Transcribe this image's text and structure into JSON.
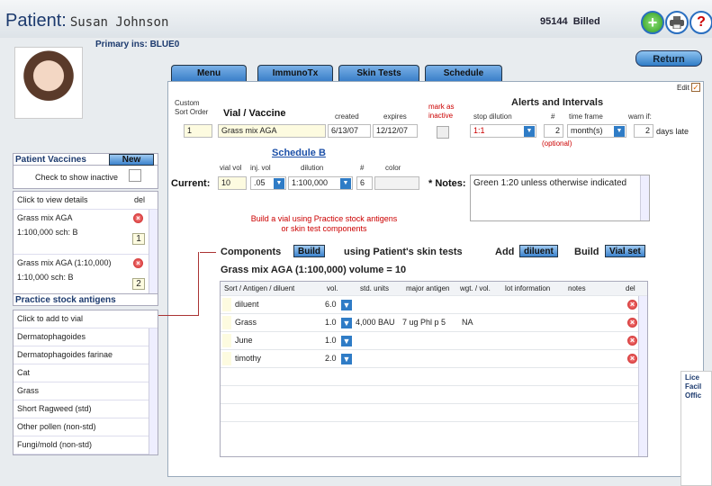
{
  "header": {
    "patient_label": "Patient:",
    "patient_name": "Susan Johnson",
    "account": "95144",
    "billed": "Billed",
    "primary_ins": "Primary ins: BLUE0"
  },
  "actions": {
    "return": "Return",
    "edit": "Edit",
    "edit_check": "✓"
  },
  "tabs": [
    "Menu",
    "ImmunoTx",
    "Skin Tests",
    "Schedule"
  ],
  "vial": {
    "custom_sort_label": "Custom\nSort Order",
    "vial_label": "Vial / Vaccine",
    "created_label": "created",
    "expires_label": "expires",
    "mark_label": "mark as\ninactive",
    "sort_value": "1",
    "vaccine": "Grass mix AGA",
    "created": "6/13/07",
    "expires": "12/12/07"
  },
  "alerts": {
    "title": "Alerts and Intervals",
    "stop_dilution_label": "stop dilution",
    "hash_label": "#",
    "time_frame_label": "time frame",
    "warn_label": "warn if:",
    "stop_dilution": "1:1",
    "count": "2",
    "time_frame": "month(s)",
    "warn_value": "2",
    "days_late": "days late",
    "optional": "(optional)"
  },
  "schedule": {
    "title": "Schedule B",
    "vial_vol_label": "vial vol",
    "inj_vol_label": "inj. vol",
    "dilution_label": "dilution",
    "hash_label": "#",
    "color_label": "color",
    "current_label": "Current:",
    "vial_vol": "10",
    "inj_vol": ".05",
    "dilution": "1:100,000",
    "number": "6"
  },
  "notes": {
    "label": "* Notes:",
    "value": "Green 1:20 unless otherwise indicated"
  },
  "build_hint": "Build a vial using Practice stock antigens\nor skin test components",
  "components": {
    "label": "Components",
    "build": "Build",
    "using": "using Patient's skin tests",
    "add": "Add",
    "diluent": "diluent",
    "build2": "Build",
    "vial_set": "Vial set",
    "subtitle": "Grass mix AGA  (1:100,000)  volume = 10",
    "columns": [
      "Sort / Antigen / diluent",
      "vol.",
      "std. units",
      "major antigen",
      "wgt. / vol.",
      "lot information",
      "notes",
      "del"
    ],
    "rows": [
      {
        "name": "diluent",
        "vol": "6.0",
        "units": "",
        "major": "",
        "wgt": "",
        "lot": ""
      },
      {
        "name": "Grass",
        "vol": "1.0",
        "units": "4,000 BAU",
        "major": "7 ug Phl p 5",
        "wgt": "NA",
        "lot": ""
      },
      {
        "name": "June",
        "vol": "1.0",
        "units": "",
        "major": "",
        "wgt": "",
        "lot": ""
      },
      {
        "name": "timothy",
        "vol": "2.0",
        "units": "",
        "major": "",
        "wgt": "",
        "lot": ""
      }
    ]
  },
  "patient_vaccines": {
    "title": "Patient Vaccines",
    "new": "New",
    "show_inactive": "Check to show inactive",
    "click_details": "Click to view details",
    "del": "del",
    "items": [
      {
        "line1": "Grass mix AGA",
        "line2": "1:100,000   sch: B",
        "badge": "1"
      },
      {
        "line1": "Grass mix AGA (1:10,000)",
        "line2": "1:10,000   sch: B",
        "badge": "2"
      }
    ]
  },
  "practice_stock": {
    "title": "Practice stock antigens",
    "click_add": "Click to add to vial",
    "items": [
      "Dermatophagoides",
      "Dermatophagoides farinae",
      "Cat",
      "Grass",
      "Short Ragweed (std)",
      "Other pollen (non-std)",
      "Fungi/mold (non-std)"
    ]
  },
  "license": "Lice\nFacil\nOffic"
}
